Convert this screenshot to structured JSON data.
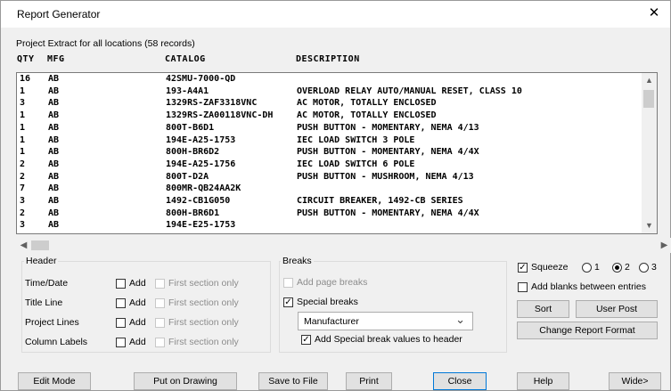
{
  "window": {
    "title": "Report Generator",
    "close_glyph": "✕"
  },
  "subtitle": "Project Extract for all locations (58 records)",
  "columns": {
    "qty": "QTY",
    "mfg": "MFG",
    "catalog": "CATALOG",
    "description": "DESCRIPTION"
  },
  "rows": [
    {
      "qty": "16",
      "mfg": "AB",
      "catalog": "42SMU-7000-QD",
      "description": ""
    },
    {
      "qty": "1",
      "mfg": "AB",
      "catalog": "193-A4A1",
      "description": "OVERLOAD RELAY AUTO/MANUAL RESET, CLASS 10"
    },
    {
      "qty": "3",
      "mfg": "AB",
      "catalog": "1329RS-ZAF3318VNC",
      "description": "AC MOTOR, TOTALLY ENCLOSED"
    },
    {
      "qty": "1",
      "mfg": "AB",
      "catalog": "1329RS-ZA00118VNC-DH",
      "description": "AC MOTOR, TOTALLY ENCLOSED"
    },
    {
      "qty": "1",
      "mfg": "AB",
      "catalog": "800T-B6D1",
      "description": "PUSH BUTTON - MOMENTARY, NEMA 4/13"
    },
    {
      "qty": "1",
      "mfg": "AB",
      "catalog": "194E-A25-1753",
      "description": "IEC LOAD SWITCH 3 POLE"
    },
    {
      "qty": "1",
      "mfg": "AB",
      "catalog": "800H-BR6D2",
      "description": "PUSH BUTTON - MOMENTARY, NEMA 4/4X"
    },
    {
      "qty": "2",
      "mfg": "AB",
      "catalog": "194E-A25-1756",
      "description": "IEC LOAD SWITCH 6 POLE"
    },
    {
      "qty": "2",
      "mfg": "AB",
      "catalog": "800T-D2A",
      "description": "PUSH BUTTON - MUSHROOM, NEMA 4/13"
    },
    {
      "qty": "7",
      "mfg": "AB",
      "catalog": "800MR-QB24AA2K",
      "description": ""
    },
    {
      "qty": "3",
      "mfg": "AB",
      "catalog": "1492-CB1G050",
      "description": "CIRCUIT BREAKER, 1492-CB SERIES"
    },
    {
      "qty": "2",
      "mfg": "AB",
      "catalog": "800H-BR6D1",
      "description": "PUSH BUTTON - MOMENTARY, NEMA 4/4X"
    },
    {
      "qty": "3",
      "mfg": "AB",
      "catalog": "194E-E25-1753",
      "description": ""
    }
  ],
  "header_group": {
    "title": "Header",
    "rows": [
      {
        "label": "Time/Date",
        "add": "Add",
        "first": "First section only"
      },
      {
        "label": "Title Line",
        "add": "Add",
        "first": "First section only"
      },
      {
        "label": "Project Lines",
        "add": "Add",
        "first": "First section only"
      },
      {
        "label": "Column Labels",
        "add": "Add",
        "first": "First section only"
      }
    ]
  },
  "breaks_group": {
    "title": "Breaks",
    "add_page_breaks": "Add page breaks",
    "special_breaks": "Special breaks",
    "special_breaks_checked": true,
    "dropdown_value": "Manufacturer",
    "add_special_to_header": "Add Special break values to header",
    "add_special_checked": true
  },
  "right_panel": {
    "squeeze": "Squeeze",
    "squeeze_checked": true,
    "radios": [
      "1",
      "2",
      "3"
    ],
    "radio_selected": "2",
    "add_blanks": "Add blanks between entries",
    "sort": "Sort",
    "user_post": "User Post",
    "change_format": "Change Report Format"
  },
  "footer": {
    "edit_mode": "Edit Mode",
    "put_on_drawing": "Put on Drawing",
    "save_to_file": "Save to File",
    "print": "Print",
    "close": "Close",
    "help": "Help",
    "wide": "Wide>"
  },
  "icons": {
    "scroll_up": "▲",
    "scroll_down": "▼",
    "scroll_left": "◀",
    "scroll_right": "▶",
    "dropdown": "⌄",
    "check": "✓"
  }
}
